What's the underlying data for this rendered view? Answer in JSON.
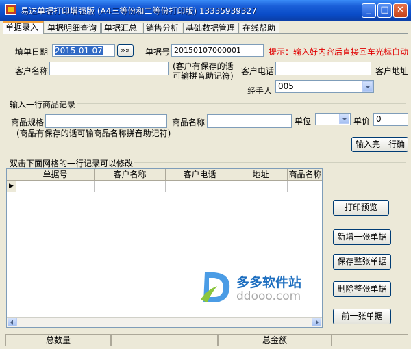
{
  "window": {
    "title": "易达单据打印增强版 (A4三等份和二等份打印版) 13335939327",
    "minimize": "_",
    "maximize": "□",
    "close": "✕"
  },
  "tabs": [
    {
      "label": "单据录入",
      "active": true
    },
    {
      "label": "单据明细查询"
    },
    {
      "label": "单据汇总"
    },
    {
      "label": "销售分析"
    },
    {
      "label": "基础数据管理"
    },
    {
      "label": "在线帮助"
    }
  ],
  "form": {
    "fill_date_label": "填单日期",
    "fill_date_value": "2015-01-07",
    "date_picker_label": "»»",
    "doc_no_label": "单据号",
    "doc_no_value": "20150107000001",
    "hint": "提示：输入好内容后直接回车光标自动",
    "customer_name_label": "客户名称",
    "customer_name_value": "",
    "customer_hint_line1": "(客户有保存的话",
    "customer_hint_line2": "可输拼音助记符)",
    "customer_phone_label": "客户电话",
    "customer_phone_value": "",
    "customer_address_label": "客户地址",
    "handler_label": "经手人",
    "handler_value": "005"
  },
  "item_section": {
    "title": "输入一行商品记录",
    "spec_label": "商品规格",
    "spec_value": "",
    "name_label": "商品名称",
    "name_value": "",
    "unit_label": "单位",
    "unit_value": "",
    "price_label": "单价",
    "price_value": "0",
    "hint": "(商品有保存的话可输商品名称拼音助记符)",
    "confirm_button": "输入完一行确"
  },
  "grid": {
    "caption": "双击下面网格的一行记录可以修改",
    "columns": [
      "单据号",
      "客户名称",
      "客户电话",
      "地址",
      "商品名称"
    ],
    "row_marker": "▶"
  },
  "actions": {
    "print_preview": "打印预览",
    "new_doc": "新增一张单据",
    "save_doc": "保存整张单据",
    "delete_doc": "删除整张单据",
    "prev_doc": "前一张单据"
  },
  "status": {
    "total_qty": "总数量",
    "total_amount": "总金额"
  },
  "watermark": {
    "brand": "多多软件站",
    "url": "ddooo.com"
  }
}
